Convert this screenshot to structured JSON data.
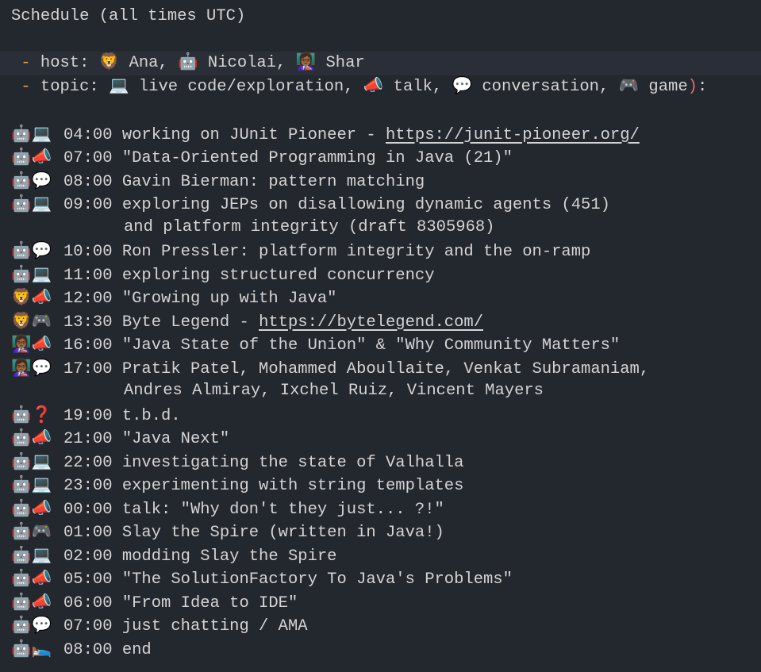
{
  "title": "Schedule (all times UTC)",
  "legend": {
    "host": {
      "dash": " - ",
      "key": "host: ",
      "items": [
        {
          "icon": "🦁",
          "name": "Ana"
        },
        {
          "icon": "🤖",
          "name": "Nicolai"
        },
        {
          "icon": "👩🏾‍🏫",
          "name": "Shar"
        }
      ]
    },
    "topic": {
      "dash": " - ",
      "key": "topic: ",
      "items": [
        {
          "icon": "💻",
          "name": "live code/exploration"
        },
        {
          "icon": "📣",
          "name": "talk"
        },
        {
          "icon": "💬",
          "name": "conversation"
        },
        {
          "icon": "🎮",
          "name": "game"
        }
      ],
      "close_paren": ")",
      "colon": ":"
    }
  },
  "schedule": [
    {
      "icons": "🤖💻",
      "time": "04:00",
      "text": "working on JUnit Pioneer - ",
      "link": "https://junit-pioneer.org/"
    },
    {
      "icons": "🤖📣",
      "time": "07:00",
      "text": "\"Data-Oriented Programming in Java (21)\""
    },
    {
      "icons": "🤖💬",
      "time": "08:00",
      "text": "Gavin Bierman: pattern matching"
    },
    {
      "icons": "🤖💻",
      "time": "09:00",
      "text": "exploring JEPs on disallowing dynamic agents (451)",
      "continuation": "and platform integrity (draft 8305968)"
    },
    {
      "icons": "🤖💬",
      "time": "10:00",
      "text": "Ron Pressler: platform integrity and the on-ramp"
    },
    {
      "icons": "🤖💻",
      "time": "11:00",
      "text": "exploring structured concurrency"
    },
    {
      "icons": "🦁📣",
      "time": "12:00",
      "text": "\"Growing up with Java\""
    },
    {
      "icons": "🦁🎮",
      "time": "13:30",
      "text": "Byte Legend - ",
      "link": "https://bytelegend.com/"
    },
    {
      "icons": "👩🏾‍🏫📣",
      "time": "16:00",
      "text": "\"Java State of the Union\" & \"Why Community Matters\""
    },
    {
      "icons": "👩🏾‍🏫💬",
      "time": "17:00",
      "text": "Pratik Patel, Mohammed Aboullaite, Venkat Subramaniam,",
      "continuation": "Andres Almiray, Ixchel Ruiz, Vincent Mayers"
    },
    {
      "icons": "🤖❓",
      "time": "19:00",
      "text": "t.b.d."
    },
    {
      "icons": "🤖📣",
      "time": "21:00",
      "text": "\"Java Next\""
    },
    {
      "icons": "🤖💻",
      "time": "22:00",
      "text": "investigating the state of Valhalla"
    },
    {
      "icons": "🤖💻",
      "time": "23:00",
      "text": "experimenting with string templates"
    },
    {
      "icons": "🤖📣",
      "time": "00:00",
      "text": "talk: \"Why don't they just... ?!\""
    },
    {
      "icons": "🤖🎮",
      "time": "01:00",
      "text": "Slay the Spire (written in Java!)"
    },
    {
      "icons": "🤖💻",
      "time": "02:00",
      "text": "modding Slay the Spire"
    },
    {
      "icons": "🤖📣",
      "time": "05:00",
      "text": "\"The SolutionFactory To Java's Problems\""
    },
    {
      "icons": "🤖📣",
      "time": "06:00",
      "text": "\"From Idea to IDE\""
    },
    {
      "icons": "🤖💬",
      "time": "07:00",
      "text": "just chatting / AMA"
    },
    {
      "icons": "🤖🛌",
      "time": "08:00",
      "text": "end"
    }
  ],
  "colors": {
    "background": "#23272e",
    "text": "#d4d4d4",
    "list_dash": "#e5a55a",
    "paren_accent": "#e06c75",
    "highlight_row": "#2a2f37"
  }
}
